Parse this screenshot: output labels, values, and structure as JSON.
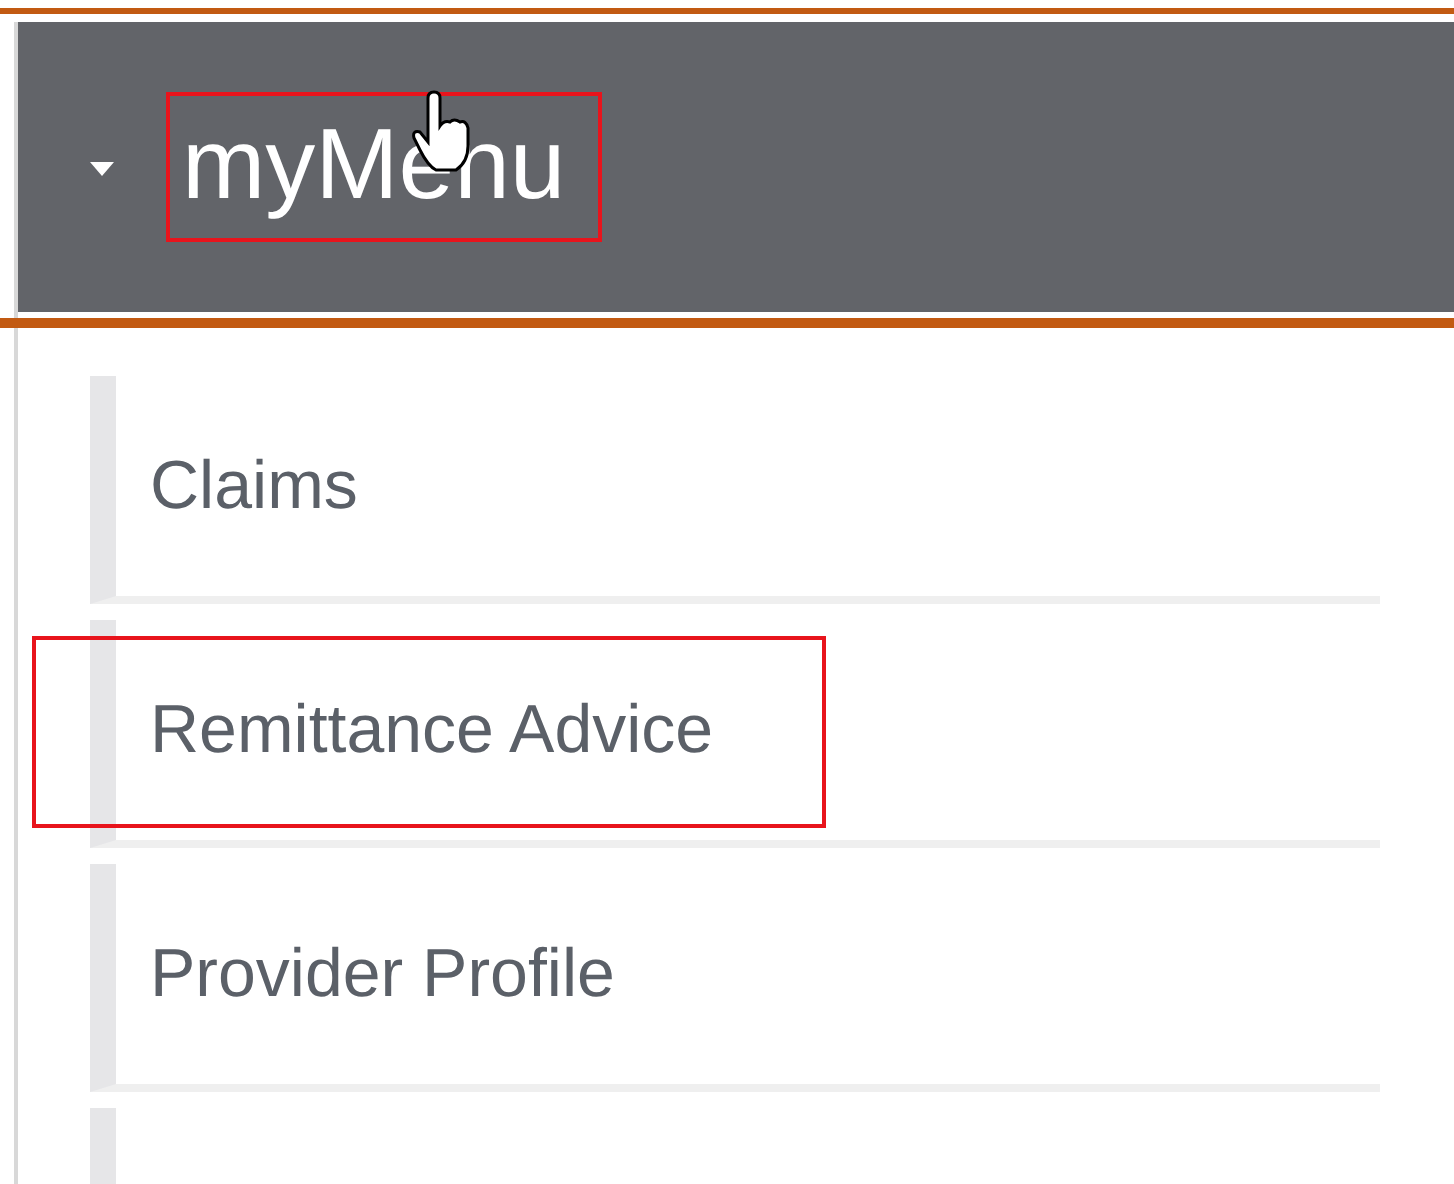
{
  "menu": {
    "title": "myMenu",
    "expanded": true,
    "highlighted": true
  },
  "items": [
    {
      "label": "Claims",
      "highlighted": false
    },
    {
      "label": "Remittance Advice",
      "highlighted": true
    },
    {
      "label": "Provider Profile",
      "highlighted": false
    }
  ]
}
